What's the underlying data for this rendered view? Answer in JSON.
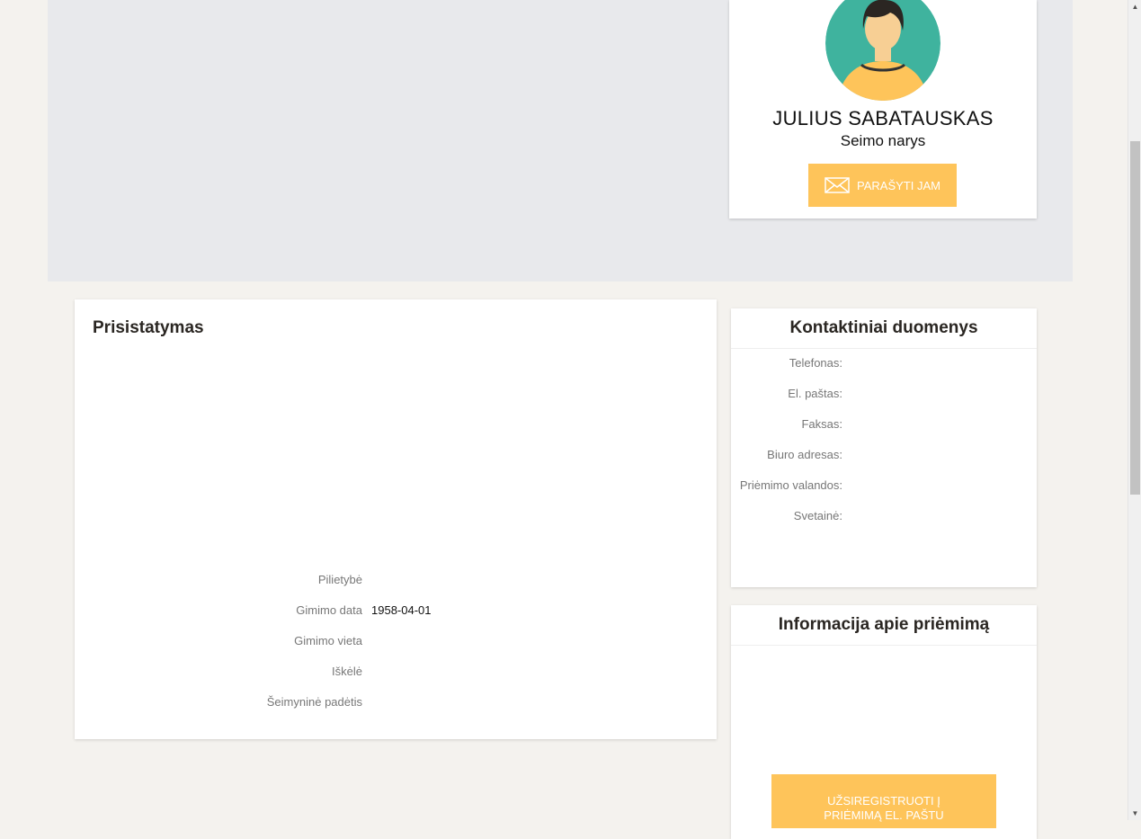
{
  "profile": {
    "name": "JULIUS SABATAUSKAS",
    "role": "Seimo narys",
    "write_button": "PARAŠYTI JAM"
  },
  "intro": {
    "title": "Prisistatymas",
    "details": [
      {
        "label": "Pilietybė",
        "value": ""
      },
      {
        "label": "Gimimo data",
        "value": "1958-04-01"
      },
      {
        "label": "Gimimo vieta",
        "value": ""
      },
      {
        "label": "Iškėlė",
        "value": ""
      },
      {
        "label": "Šeimyninė padėtis",
        "value": ""
      }
    ]
  },
  "contacts": {
    "title": "Kontaktiniai duomenys",
    "rows": [
      {
        "label": "Telefonas:",
        "value": ""
      },
      {
        "label": "El. paštas:",
        "value": ""
      },
      {
        "label": "Faksas:",
        "value": ""
      },
      {
        "label": "Biuro adresas:",
        "value": ""
      },
      {
        "label": "Priėmimo valandos:",
        "value": ""
      },
      {
        "label": "Svetainė:",
        "value": ""
      }
    ]
  },
  "reception": {
    "title": "Informacija apie priėmimą",
    "register_button": "UŽSIREGISTRUOTI Į PRIĖMIMĄ EL. PAŠTU"
  },
  "colors": {
    "accent": "#fec45a",
    "avatar_bg": "#3fb39e",
    "hero_bg": "#e8e9ec",
    "page_bg": "#f4f2ee"
  },
  "icons": {
    "avatar": "person-avatar",
    "write": "envelope-icon"
  }
}
